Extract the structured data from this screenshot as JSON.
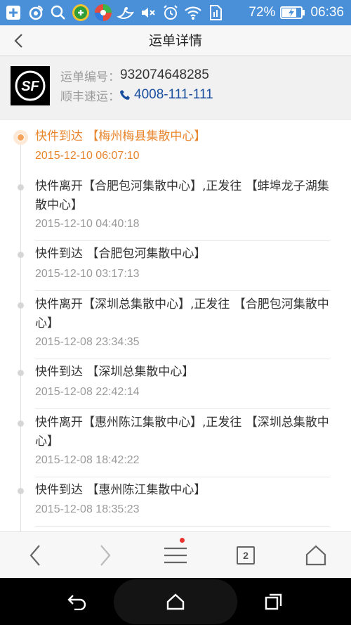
{
  "status_bar": {
    "battery_percent": "72%",
    "time": "06:36",
    "icons": [
      "add-box-icon",
      "weibo-icon",
      "search-icon",
      "shopping-icon",
      "browser-icon",
      "bird-icon",
      "mute-icon",
      "alarm-icon",
      "wifi-icon",
      "sim-icon",
      "battery-icon"
    ]
  },
  "header": {
    "title": "运单详情"
  },
  "info": {
    "waybill_label": "运单编号：",
    "waybill_number": "932074648285",
    "carrier_label": "顺丰速运：",
    "phone": "4008-111-111"
  },
  "timeline": [
    {
      "text": "快件到达 【梅州梅县集散中心】",
      "time": "2015-12-10 06:07:10",
      "current": true
    },
    {
      "text": "快件离开【合肥包河集散中心】,正发往 【蚌埠龙子湖集散中心】",
      "time": "2015-12-10 04:40:18"
    },
    {
      "text": "快件到达 【合肥包河集散中心】",
      "time": "2015-12-10 03:17:13"
    },
    {
      "text": "快件离开【深圳总集散中心】,正发往 【合肥包河集散中心】",
      "time": "2015-12-08 23:34:35"
    },
    {
      "text": "快件到达 【深圳总集散中心】",
      "time": "2015-12-08 22:42:14"
    },
    {
      "text": "快件离开【惠州陈江集散中心】,正发往 【深圳总集散中心】",
      "time": "2015-12-08 18:42:22"
    },
    {
      "text": "快件到达 【惠州陈江集散中心】",
      "time": "2015-12-08 18:35:23"
    }
  ],
  "browser_bar": {
    "tab_count": "2"
  },
  "colors": {
    "status_bar": "#4a90d9",
    "accent_orange": "#e8862e",
    "phone_blue": "#1a4fa0"
  }
}
